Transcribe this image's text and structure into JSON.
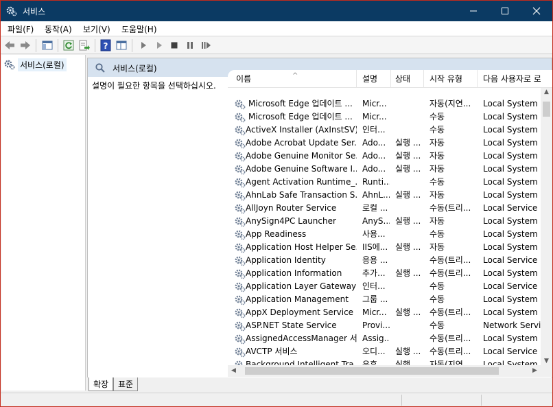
{
  "window": {
    "title": "서비스",
    "controls": {
      "minimize": "—",
      "maximize": "☐",
      "close": "✕"
    }
  },
  "menu": [
    {
      "label": "파일(F)"
    },
    {
      "label": "동작(A)"
    },
    {
      "label": "보기(V)"
    },
    {
      "label": "도움말(H)"
    }
  ],
  "toolbar": {
    "buttons": [
      "back-arrow-icon",
      "forward-arrow-icon",
      "show-hide-console-tree-icon",
      "refresh-icon",
      "export-list-icon",
      "help-icon",
      "properties-pane-icon",
      "play-icon",
      "play-alt-icon",
      "stop-icon",
      "pause-icon",
      "restart-icon"
    ]
  },
  "tree": {
    "root_label": "서비스(로컬)"
  },
  "pane": {
    "header_title": "서비스(로컬)",
    "description": "설명이 필요한 항목을 선택하십시오."
  },
  "table": {
    "columns": [
      "이름",
      "설명",
      "상태",
      "시작 유형",
      "다음 사용자로 로"
    ],
    "sort_indicator": "^",
    "rows": [
      {
        "name": "Microsoft Edge 업데이트 ...",
        "desc": "Micr...",
        "status": "",
        "startup": "자동(지연...",
        "logon": "Local System"
      },
      {
        "name": "Microsoft Edge 업데이트 ...",
        "desc": "Micr...",
        "status": "",
        "startup": "수동",
        "logon": "Local System"
      },
      {
        "name": "ActiveX Installer (AxInstSV)",
        "desc": "인터...",
        "status": "",
        "startup": "수동",
        "logon": "Local System"
      },
      {
        "name": "Adobe Acrobat Update Ser...",
        "desc": "Ado...",
        "status": "실행 ...",
        "startup": "자동",
        "logon": "Local System"
      },
      {
        "name": "Adobe Genuine Monitor Se...",
        "desc": "Ado...",
        "status": "실행 ...",
        "startup": "자동",
        "logon": "Local System"
      },
      {
        "name": "Adobe Genuine Software I...",
        "desc": "Ado...",
        "status": "실행 ...",
        "startup": "자동",
        "logon": "Local System"
      },
      {
        "name": "Agent Activation Runtime_...",
        "desc": "Runti...",
        "status": "",
        "startup": "수동",
        "logon": "Local System"
      },
      {
        "name": "AhnLab Safe Transaction S...",
        "desc": "AhnL...",
        "status": "실행 ...",
        "startup": "자동",
        "logon": "Local System"
      },
      {
        "name": "AllJoyn Router Service",
        "desc": "로컬 ...",
        "status": "",
        "startup": "수동(트리...",
        "logon": "Local Service"
      },
      {
        "name": "AnySign4PC Launcher",
        "desc": "AnyS...",
        "status": "실행 ...",
        "startup": "자동",
        "logon": "Local System"
      },
      {
        "name": "App Readiness",
        "desc": "사용...",
        "status": "",
        "startup": "수동",
        "logon": "Local System"
      },
      {
        "name": "Application Host Helper Se...",
        "desc": "IIS에...",
        "status": "실행 ...",
        "startup": "자동",
        "logon": "Local System"
      },
      {
        "name": "Application Identity",
        "desc": "응용 ...",
        "status": "",
        "startup": "수동(트리...",
        "logon": "Local Service"
      },
      {
        "name": "Application Information",
        "desc": "추가...",
        "status": "실행 ...",
        "startup": "수동(트리...",
        "logon": "Local System"
      },
      {
        "name": "Application Layer Gateway ...",
        "desc": "인터...",
        "status": "",
        "startup": "수동",
        "logon": "Local Service"
      },
      {
        "name": "Application Management",
        "desc": "그룹 ...",
        "status": "",
        "startup": "수동",
        "logon": "Local System"
      },
      {
        "name": "AppX Deployment Service ...",
        "desc": "Micr...",
        "status": "실행 ...",
        "startup": "수동(트리...",
        "logon": "Local System"
      },
      {
        "name": "ASP.NET State Service",
        "desc": "Provi...",
        "status": "",
        "startup": "수동",
        "logon": "Network Service"
      },
      {
        "name": "AssignedAccessManager 서...",
        "desc": "Assig...",
        "status": "",
        "startup": "수동(트리...",
        "logon": "Local System"
      },
      {
        "name": "AVCTP 서비스",
        "desc": "오디...",
        "status": "실행 ...",
        "startup": "수동(트리...",
        "logon": "Local Service"
      },
      {
        "name": "Background Intelligent Tra...",
        "desc": "유휴 ...",
        "status": "실행 ...",
        "startup": "자동(지연...",
        "logon": "Local System"
      }
    ]
  },
  "tabs": [
    {
      "label": "확장",
      "active": true
    },
    {
      "label": "표준",
      "active": false
    }
  ],
  "colors": {
    "titlebar": "#0b3a63",
    "pane_header": "#d6e2ef",
    "window_border": "#c42b1c",
    "tree_selection": "#e5f1fb"
  }
}
